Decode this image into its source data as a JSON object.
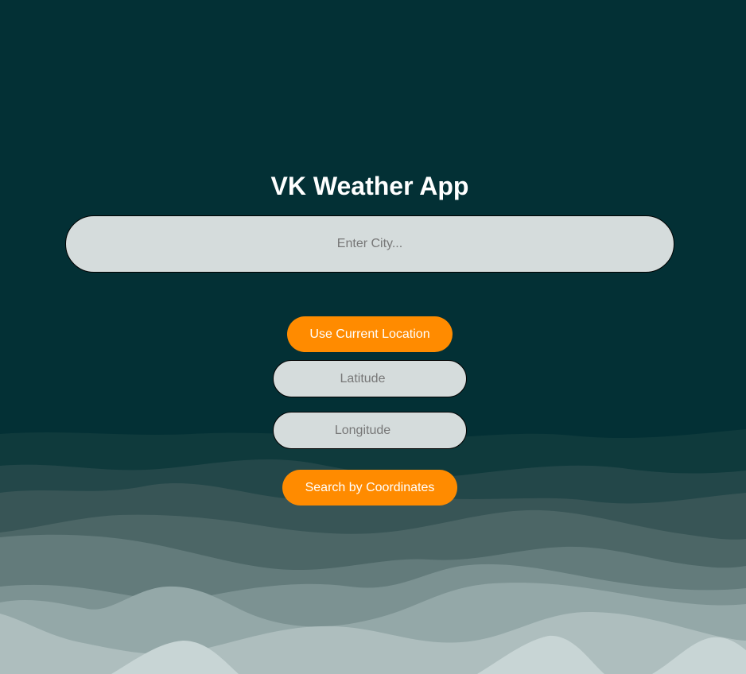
{
  "app": {
    "title": "VK Weather App"
  },
  "search": {
    "city_placeholder": "Enter City..."
  },
  "location": {
    "use_current_label": "Use Current Location"
  },
  "coordinates": {
    "latitude_placeholder": "Latitude",
    "longitude_placeholder": "Longitude",
    "search_label": "Search by Coordinates"
  },
  "theme": {
    "background": "#033035",
    "accent": "#ff8b00",
    "input_background": "#d5dcdc"
  }
}
